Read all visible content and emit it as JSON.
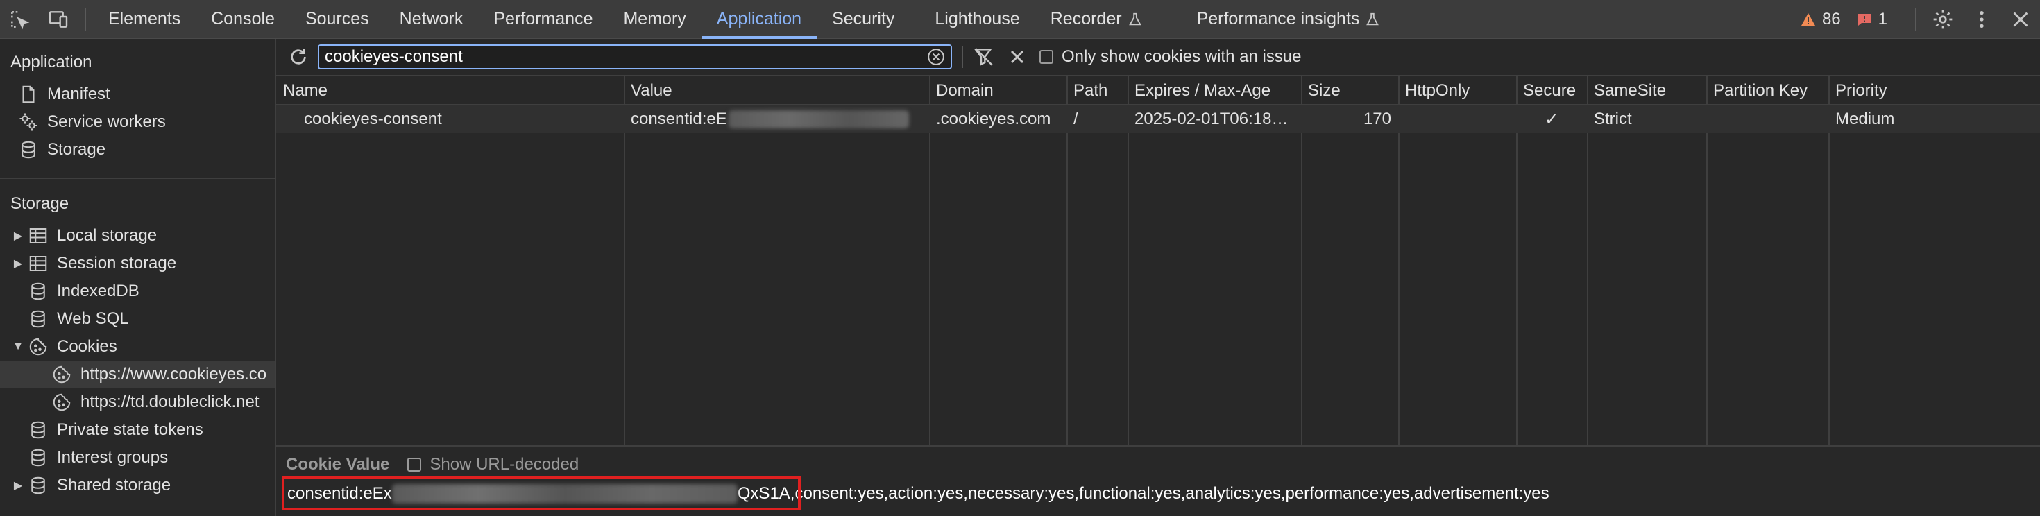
{
  "toolbar": {
    "tabs": [
      {
        "label": "Elements"
      },
      {
        "label": "Console"
      },
      {
        "label": "Sources"
      },
      {
        "label": "Network"
      },
      {
        "label": "Performance"
      },
      {
        "label": "Memory"
      },
      {
        "label": "Application"
      },
      {
        "label": "Security"
      },
      {
        "label": "Lighthouse"
      },
      {
        "label": "Recorder"
      },
      {
        "label": "Performance insights"
      }
    ],
    "active_tab": "Application",
    "warnings_count": "86",
    "errors_count": "1",
    "colors": {
      "active_tab": "#8ab4f8",
      "warning": "#f28b54",
      "error": "#e46962"
    }
  },
  "sidebar": {
    "application_title": "Application",
    "application_items": [
      {
        "label": "Manifest",
        "icon": "document-icon"
      },
      {
        "label": "Service workers",
        "icon": "gears-icon"
      },
      {
        "label": "Storage",
        "icon": "database-icon"
      }
    ],
    "storage_title": "Storage",
    "storage_items": [
      {
        "label": "Local storage",
        "icon": "table-icon",
        "expander": "collapsed"
      },
      {
        "label": "Session storage",
        "icon": "table-icon",
        "expander": "collapsed"
      },
      {
        "label": "IndexedDB",
        "icon": "database-icon"
      },
      {
        "label": "Web SQL",
        "icon": "database-icon"
      },
      {
        "label": "Cookies",
        "icon": "cookie-icon",
        "expander": "expanded"
      },
      {
        "label": "https://www.cookieyes.co",
        "icon": "cookie-icon",
        "selected": true
      },
      {
        "label": "https://td.doubleclick.net",
        "icon": "cookie-icon"
      },
      {
        "label": "Private state tokens",
        "icon": "database-icon"
      },
      {
        "label": "Interest groups",
        "icon": "database-icon"
      },
      {
        "label": "Shared storage",
        "icon": "database-icon",
        "expander": "collapsed"
      }
    ]
  },
  "filter": {
    "value": "cookieyes-consent",
    "only_issue_label": "Only show cookies with an issue"
  },
  "table": {
    "columns": [
      "Name",
      "Value",
      "Domain",
      "Path",
      "Expires / Max-Age",
      "Size",
      "HttpOnly",
      "Secure",
      "SameSite",
      "Partition Key",
      "Priority"
    ],
    "rows": [
      {
        "name": "cookieyes-consent",
        "value_prefix": "consentid:eE",
        "domain": ".cookieyes.com",
        "path": "/",
        "expires": "2025-02-01T06:18…",
        "size": "170",
        "httponly": "",
        "secure": "✓",
        "samesite": "Strict",
        "partition_key": "",
        "priority": "Medium"
      }
    ]
  },
  "cookie_value": {
    "title": "Cookie Value",
    "decode_label": "Show URL-decoded",
    "value_prefix": "consentid:eEx",
    "value_mid_suffix": "QxS1A",
    "value_rest": ",consent:yes,action:yes,necessary:yes,functional:yes,analytics:yes,performance:yes,advertisement:yes"
  }
}
